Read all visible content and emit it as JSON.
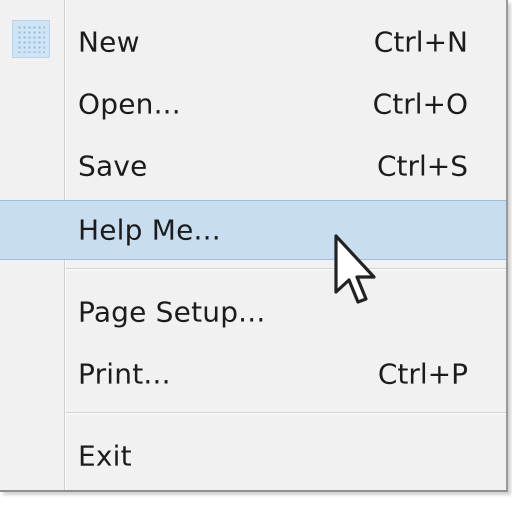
{
  "menu": {
    "items": [
      {
        "label": "New",
        "shortcut": "Ctrl+N"
      },
      {
        "label": "Open...",
        "shortcut": "Ctrl+O"
      },
      {
        "label": "Save",
        "shortcut": "Ctrl+S"
      },
      {
        "label": "Help Me...",
        "shortcut": ""
      },
      {
        "label": "Page Setup...",
        "shortcut": ""
      },
      {
        "label": "Print...",
        "shortcut": "Ctrl+P"
      },
      {
        "label": "Exit",
        "shortcut": ""
      }
    ],
    "highlighted_item": "Help Me..."
  },
  "colors": {
    "menu_background": "#f1f1f1",
    "highlight_background": "#c9ddf1",
    "highlight_border": "#9cc0e2",
    "text": "#1c1c1c"
  },
  "icons": {
    "app_icon": "app-icon",
    "cursor": "mouse-pointer-icon"
  }
}
